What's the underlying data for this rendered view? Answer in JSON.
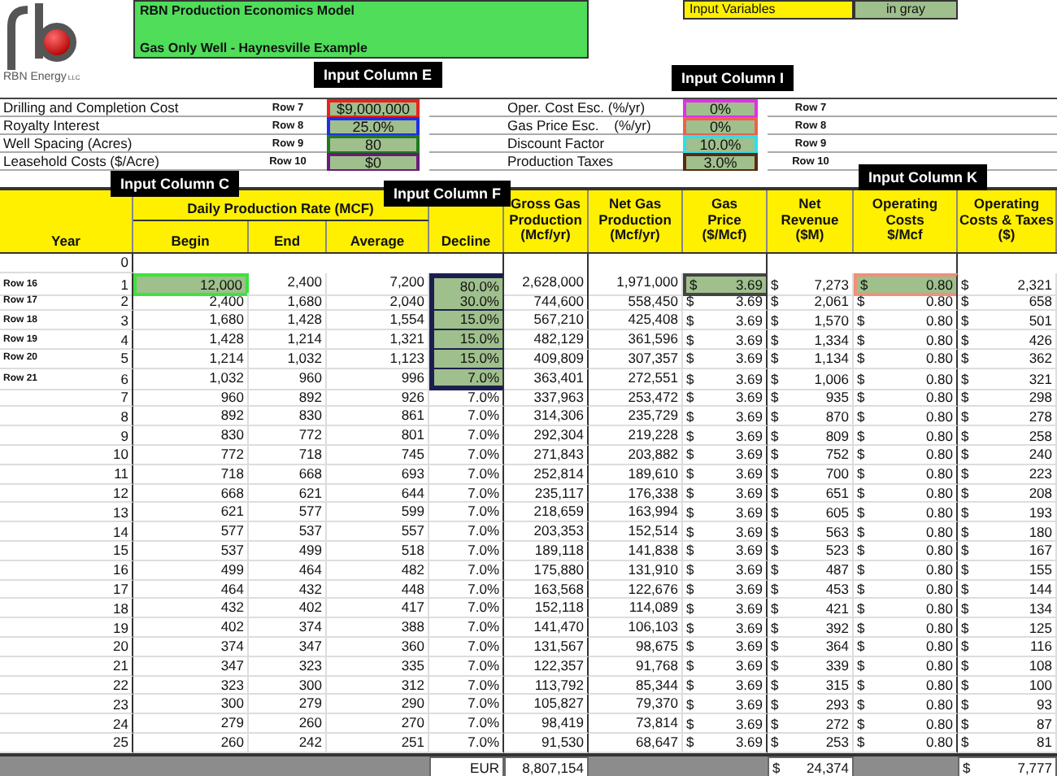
{
  "logo": {
    "name": "RBN Energy",
    "suffix": "LLC"
  },
  "title": {
    "line_1": "RBN Production Economics Model",
    "line_2": "Gas Only Well - Haynesville Example"
  },
  "legend": {
    "label": "Input Variables",
    "note": "in gray"
  },
  "callouts": [
    "Input Column E",
    "Input Column I",
    "Input Column K",
    "Input Column C",
    "Input Column F"
  ],
  "parameters": {
    "left": [
      {
        "label": "Drilling and Completion Cost",
        "row_ref": "Row 7",
        "value": "$9,000,000",
        "color": "#e8231e"
      },
      {
        "label": "Royalty Interest",
        "row_ref": "Row 8",
        "value": "25.0%",
        "color": "#1f2fe0"
      },
      {
        "label": "Well Spacing (Acres)",
        "row_ref": "Row 9",
        "value": "80",
        "color": "#1f7a1f"
      },
      {
        "label": "Leasehold Costs ($/Acre)",
        "row_ref": "Row 10",
        "value": "$0",
        "color": "#6a1a7a"
      }
    ],
    "right": [
      {
        "label": "Oper. Cost Esc. (%/yr)",
        "row_ref": "Row 7",
        "value": "0%",
        "color": "#e030e8"
      },
      {
        "label": "Gas Price Esc.    (%/yr)",
        "row_ref": "Row 8",
        "value": "0%",
        "color": "#f0604a"
      },
      {
        "label": "Discount Factor",
        "row_ref": "Row 9",
        "value": "10.0%",
        "color": "#28e0f0"
      },
      {
        "label": "Production Taxes",
        "row_ref": "Row 10",
        "value": "3.0%",
        "color": "#5a2a10"
      }
    ]
  },
  "table": {
    "year_label": "Year",
    "group_label": "Daily Production Rate (MCF)",
    "columns": [
      {
        "lines": [
          "Begin"
        ]
      },
      {
        "lines": [
          "End"
        ]
      },
      {
        "lines": [
          "Average"
        ]
      },
      {
        "lines": [
          "Decline"
        ]
      },
      {
        "lines": [
          "Gross Gas",
          "Production",
          "(Mcf/yr)"
        ]
      },
      {
        "lines": [
          "Net Gas",
          "Production",
          "(Mcf/yr)"
        ]
      },
      {
        "lines": [
          "Gas",
          "Price",
          "($/Mcf)"
        ]
      },
      {
        "lines": [
          "Net",
          "Revenue",
          "($M)"
        ]
      },
      {
        "lines": [
          "Operating",
          "Costs",
          "$/Mcf"
        ]
      },
      {
        "lines": [
          "Operating",
          "Costs & Taxes",
          "($)"
        ]
      }
    ],
    "rows": [
      {
        "year": "0",
        "cells": []
      },
      {
        "row_ref": "Row 16",
        "year": "1",
        "cells": [
          {
            "value": "12,000",
            "input": true,
            "color": "#3ee23e"
          },
          "2,400",
          "7,200",
          {
            "value": "80.0%",
            "input": true,
            "color": "#1b1f4f"
          },
          "2,628,000",
          "1,971,000",
          {
            "symbol": "$",
            "value": "3.69",
            "input": true,
            "color": "#444444"
          },
          {
            "symbol": "$",
            "value": "7,273"
          },
          {
            "symbol": "$",
            "value": "0.80",
            "input": true,
            "color": "#f0907a"
          },
          {
            "symbol": "$",
            "value": "2,321"
          }
        ]
      },
      {
        "row_ref": "Row 17",
        "year": "2",
        "cells": [
          {
            "value": "2,400",
            "input": false
          },
          "1,680",
          "2,040",
          {
            "value": "30.0%",
            "input": true,
            "color": "#1b1f4f"
          },
          "744,600",
          "558,450",
          {
            "symbol": "$",
            "value": "3.69",
            "input": false
          },
          {
            "symbol": "$",
            "value": "2,061"
          },
          {
            "symbol": "$",
            "value": "0.80",
            "input": false
          },
          {
            "symbol": "$",
            "value": "658"
          }
        ]
      },
      {
        "row_ref": "Row 18",
        "year": "3",
        "cells": [
          {
            "value": "1,680",
            "input": false
          },
          "1,428",
          "1,554",
          {
            "value": "15.0%",
            "input": true,
            "color": "#1b1f4f"
          },
          "567,210",
          "425,408",
          {
            "symbol": "$",
            "value": "3.69",
            "input": false
          },
          {
            "symbol": "$",
            "value": "1,570"
          },
          {
            "symbol": "$",
            "value": "0.80",
            "input": false
          },
          {
            "symbol": "$",
            "value": "501"
          }
        ]
      },
      {
        "row_ref": "Row 19",
        "year": "4",
        "cells": [
          {
            "value": "1,428",
            "input": false
          },
          "1,214",
          "1,321",
          {
            "value": "15.0%",
            "input": true,
            "color": "#1b1f4f"
          },
          "482,129",
          "361,596",
          {
            "symbol": "$",
            "value": "3.69",
            "input": false
          },
          {
            "symbol": "$",
            "value": "1,334"
          },
          {
            "symbol": "$",
            "value": "0.80",
            "input": false
          },
          {
            "symbol": "$",
            "value": "426"
          }
        ]
      },
      {
        "row_ref": "Row 20",
        "year": "5",
        "cells": [
          {
            "value": "1,214",
            "input": false
          },
          "1,032",
          "1,123",
          {
            "value": "15.0%",
            "input": true,
            "color": "#1b1f4f"
          },
          "409,809",
          "307,357",
          {
            "symbol": "$",
            "value": "3.69",
            "input": false
          },
          {
            "symbol": "$",
            "value": "1,134"
          },
          {
            "symbol": "$",
            "value": "0.80",
            "input": false
          },
          {
            "symbol": "$",
            "value": "362"
          }
        ]
      },
      {
        "row_ref": "Row 21",
        "year": "6",
        "cells": [
          {
            "value": "1,032",
            "input": false
          },
          "960",
          "996",
          {
            "value": "7.0%",
            "input": true,
            "color": "#1b1f4f"
          },
          "363,401",
          "272,551",
          {
            "symbol": "$",
            "value": "3.69",
            "input": false
          },
          {
            "symbol": "$",
            "value": "1,006"
          },
          {
            "symbol": "$",
            "value": "0.80",
            "input": false
          },
          {
            "symbol": "$",
            "value": "321"
          }
        ]
      },
      {
        "year": "7",
        "cells": [
          {
            "value": "960",
            "input": false
          },
          "892",
          "926",
          {
            "value": "7.0%",
            "input": false
          },
          "337,963",
          "253,472",
          {
            "symbol": "$",
            "value": "3.69",
            "input": false
          },
          {
            "symbol": "$",
            "value": "935"
          },
          {
            "symbol": "$",
            "value": "0.80",
            "input": false
          },
          {
            "symbol": "$",
            "value": "298"
          }
        ]
      },
      {
        "year": "8",
        "cells": [
          {
            "value": "892",
            "input": false
          },
          "830",
          "861",
          {
            "value": "7.0%",
            "input": false
          },
          "314,306",
          "235,729",
          {
            "symbol": "$",
            "value": "3.69",
            "input": false
          },
          {
            "symbol": "$",
            "value": "870"
          },
          {
            "symbol": "$",
            "value": "0.80",
            "input": false
          },
          {
            "symbol": "$",
            "value": "278"
          }
        ]
      },
      {
        "year": "9",
        "cells": [
          {
            "value": "830",
            "input": false
          },
          "772",
          "801",
          {
            "value": "7.0%",
            "input": false
          },
          "292,304",
          "219,228",
          {
            "symbol": "$",
            "value": "3.69",
            "input": false
          },
          {
            "symbol": "$",
            "value": "809"
          },
          {
            "symbol": "$",
            "value": "0.80",
            "input": false
          },
          {
            "symbol": "$",
            "value": "258"
          }
        ]
      },
      {
        "year": "10",
        "cells": [
          {
            "value": "772",
            "input": false
          },
          "718",
          "745",
          {
            "value": "7.0%",
            "input": false
          },
          "271,843",
          "203,882",
          {
            "symbol": "$",
            "value": "3.69",
            "input": false
          },
          {
            "symbol": "$",
            "value": "752"
          },
          {
            "symbol": "$",
            "value": "0.80",
            "input": false
          },
          {
            "symbol": "$",
            "value": "240"
          }
        ]
      },
      {
        "year": "11",
        "cells": [
          {
            "value": "718",
            "input": false
          },
          "668",
          "693",
          {
            "value": "7.0%",
            "input": false
          },
          "252,814",
          "189,610",
          {
            "symbol": "$",
            "value": "3.69",
            "input": false
          },
          {
            "symbol": "$",
            "value": "700"
          },
          {
            "symbol": "$",
            "value": "0.80",
            "input": false
          },
          {
            "symbol": "$",
            "value": "223"
          }
        ]
      },
      {
        "year": "12",
        "cells": [
          {
            "value": "668",
            "input": false
          },
          "621",
          "644",
          {
            "value": "7.0%",
            "input": false
          },
          "235,117",
          "176,338",
          {
            "symbol": "$",
            "value": "3.69",
            "input": false
          },
          {
            "symbol": "$",
            "value": "651"
          },
          {
            "symbol": "$",
            "value": "0.80",
            "input": false
          },
          {
            "symbol": "$",
            "value": "208"
          }
        ]
      },
      {
        "year": "13",
        "cells": [
          {
            "value": "621",
            "input": false
          },
          "577",
          "599",
          {
            "value": "7.0%",
            "input": false
          },
          "218,659",
          "163,994",
          {
            "symbol": "$",
            "value": "3.69",
            "input": false
          },
          {
            "symbol": "$",
            "value": "605"
          },
          {
            "symbol": "$",
            "value": "0.80",
            "input": false
          },
          {
            "symbol": "$",
            "value": "193"
          }
        ]
      },
      {
        "year": "14",
        "cells": [
          {
            "value": "577",
            "input": false
          },
          "537",
          "557",
          {
            "value": "7.0%",
            "input": false
          },
          "203,353",
          "152,514",
          {
            "symbol": "$",
            "value": "3.69",
            "input": false
          },
          {
            "symbol": "$",
            "value": "563"
          },
          {
            "symbol": "$",
            "value": "0.80",
            "input": false
          },
          {
            "symbol": "$",
            "value": "180"
          }
        ]
      },
      {
        "year": "15",
        "cells": [
          {
            "value": "537",
            "input": false
          },
          "499",
          "518",
          {
            "value": "7.0%",
            "input": false
          },
          "189,118",
          "141,838",
          {
            "symbol": "$",
            "value": "3.69",
            "input": false
          },
          {
            "symbol": "$",
            "value": "523"
          },
          {
            "symbol": "$",
            "value": "0.80",
            "input": false
          },
          {
            "symbol": "$",
            "value": "167"
          }
        ]
      },
      {
        "year": "16",
        "cells": [
          {
            "value": "499",
            "input": false
          },
          "464",
          "482",
          {
            "value": "7.0%",
            "input": false
          },
          "175,880",
          "131,910",
          {
            "symbol": "$",
            "value": "3.69",
            "input": false
          },
          {
            "symbol": "$",
            "value": "487"
          },
          {
            "symbol": "$",
            "value": "0.80",
            "input": false
          },
          {
            "symbol": "$",
            "value": "155"
          }
        ]
      },
      {
        "year": "17",
        "cells": [
          {
            "value": "464",
            "input": false
          },
          "432",
          "448",
          {
            "value": "7.0%",
            "input": false
          },
          "163,568",
          "122,676",
          {
            "symbol": "$",
            "value": "3.69",
            "input": false
          },
          {
            "symbol": "$",
            "value": "453"
          },
          {
            "symbol": "$",
            "value": "0.80",
            "input": false
          },
          {
            "symbol": "$",
            "value": "144"
          }
        ]
      },
      {
        "year": "18",
        "cells": [
          {
            "value": "432",
            "input": false
          },
          "402",
          "417",
          {
            "value": "7.0%",
            "input": false
          },
          "152,118",
          "114,089",
          {
            "symbol": "$",
            "value": "3.69",
            "input": false
          },
          {
            "symbol": "$",
            "value": "421"
          },
          {
            "symbol": "$",
            "value": "0.80",
            "input": false
          },
          {
            "symbol": "$",
            "value": "134"
          }
        ]
      },
      {
        "year": "19",
        "cells": [
          {
            "value": "402",
            "input": false
          },
          "374",
          "388",
          {
            "value": "7.0%",
            "input": false
          },
          "141,470",
          "106,103",
          {
            "symbol": "$",
            "value": "3.69",
            "input": false
          },
          {
            "symbol": "$",
            "value": "392"
          },
          {
            "symbol": "$",
            "value": "0.80",
            "input": false
          },
          {
            "symbol": "$",
            "value": "125"
          }
        ]
      },
      {
        "year": "20",
        "cells": [
          {
            "value": "374",
            "input": false
          },
          "347",
          "360",
          {
            "value": "7.0%",
            "input": false
          },
          "131,567",
          "98,675",
          {
            "symbol": "$",
            "value": "3.69",
            "input": false
          },
          {
            "symbol": "$",
            "value": "364"
          },
          {
            "symbol": "$",
            "value": "0.80",
            "input": false
          },
          {
            "symbol": "$",
            "value": "116"
          }
        ]
      },
      {
        "year": "21",
        "cells": [
          {
            "value": "347",
            "input": false
          },
          "323",
          "335",
          {
            "value": "7.0%",
            "input": false
          },
          "122,357",
          "91,768",
          {
            "symbol": "$",
            "value": "3.69",
            "input": false
          },
          {
            "symbol": "$",
            "value": "339"
          },
          {
            "symbol": "$",
            "value": "0.80",
            "input": false
          },
          {
            "symbol": "$",
            "value": "108"
          }
        ]
      },
      {
        "year": "22",
        "cells": [
          {
            "value": "323",
            "input": false
          },
          "300",
          "312",
          {
            "value": "7.0%",
            "input": false
          },
          "113,792",
          "85,344",
          {
            "symbol": "$",
            "value": "3.69",
            "input": false
          },
          {
            "symbol": "$",
            "value": "315"
          },
          {
            "symbol": "$",
            "value": "0.80",
            "input": false
          },
          {
            "symbol": "$",
            "value": "100"
          }
        ]
      },
      {
        "year": "23",
        "cells": [
          {
            "value": "300",
            "input": false
          },
          "279",
          "290",
          {
            "value": "7.0%",
            "input": false
          },
          "105,827",
          "79,370",
          {
            "symbol": "$",
            "value": "3.69",
            "input": false
          },
          {
            "symbol": "$",
            "value": "293"
          },
          {
            "symbol": "$",
            "value": "0.80",
            "input": false
          },
          {
            "symbol": "$",
            "value": "93"
          }
        ]
      },
      {
        "year": "24",
        "cells": [
          {
            "value": "279",
            "input": false
          },
          "260",
          "270",
          {
            "value": "7.0%",
            "input": false
          },
          "98,419",
          "73,814",
          {
            "symbol": "$",
            "value": "3.69",
            "input": false
          },
          {
            "symbol": "$",
            "value": "272"
          },
          {
            "symbol": "$",
            "value": "0.80",
            "input": false
          },
          {
            "symbol": "$",
            "value": "87"
          }
        ]
      },
      {
        "year": "25",
        "cells": [
          {
            "value": "260",
            "input": false
          },
          "242",
          "251",
          {
            "value": "7.0%",
            "input": false
          },
          "91,530",
          "68,647",
          {
            "symbol": "$",
            "value": "3.69",
            "input": false
          },
          {
            "symbol": "$",
            "value": "253"
          },
          {
            "symbol": "$",
            "value": "0.80",
            "input": false
          },
          {
            "symbol": "$",
            "value": "81"
          }
        ]
      }
    ],
    "totals": {
      "label": "EUR",
      "gross_gas": "8,807,154",
      "net_revenue": {
        "symbol": "$",
        "value": "24,374"
      },
      "costs_and_taxes": {
        "symbol": "$",
        "value": "7,777"
      }
    }
  }
}
